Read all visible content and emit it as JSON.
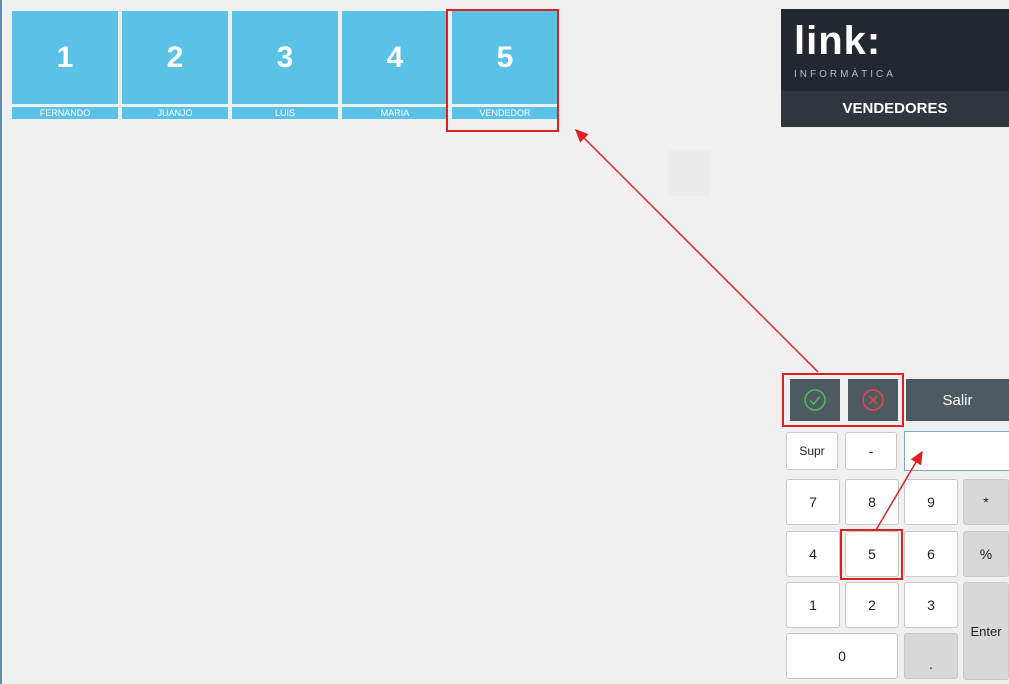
{
  "sellers": [
    {
      "number": "1",
      "name": "FERNANDO"
    },
    {
      "number": "2",
      "name": "JUANJO"
    },
    {
      "number": "3",
      "name": "LUIS"
    },
    {
      "number": "4",
      "name": "MARIA"
    },
    {
      "number": "5",
      "name": "VENDEDOR"
    }
  ],
  "brand": {
    "logo": "link:",
    "subtitle": "INFORMÁTICA",
    "section": "VENDEDORES"
  },
  "actions": {
    "accept_icon": "check-circle-icon",
    "cancel_icon": "x-circle-icon",
    "exit_label": "Salir"
  },
  "keypad": {
    "supr": "Supr",
    "minus": "-",
    "k7": "7",
    "k8": "8",
    "k9": "9",
    "times": "*",
    "k4": "4",
    "k5": "5",
    "k6": "6",
    "percent": "%",
    "k1": "1",
    "k2": "2",
    "k3": "3",
    "enter": "Enter",
    "k0": "0",
    "dot": "."
  },
  "entry": {
    "value": ""
  },
  "colors": {
    "tile": "#5bc2e7",
    "brand_bg": "#23272f",
    "action_bg": "#4d5a62",
    "annotation": "#e02020",
    "accept": "#4cc15a",
    "cancel": "#e0454b"
  }
}
